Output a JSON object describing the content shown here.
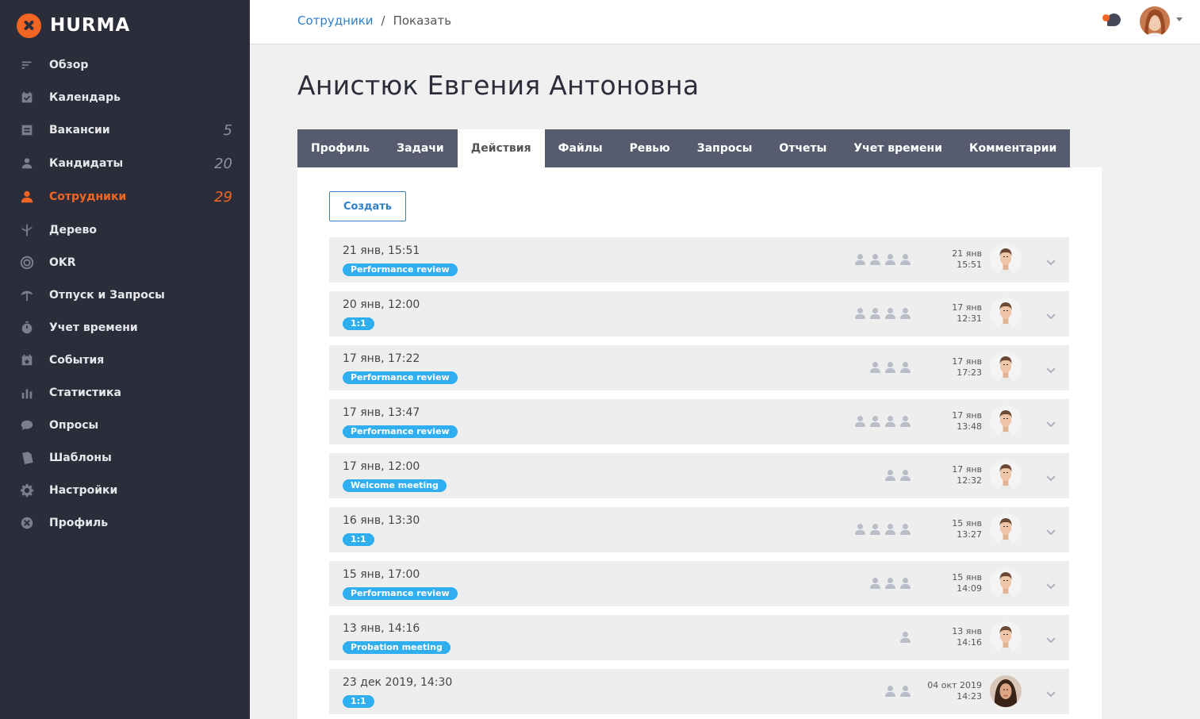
{
  "app": {
    "name": "HURMA"
  },
  "sidebar": {
    "items": [
      {
        "label": "Обзор",
        "icon": "overview-icon",
        "count": ""
      },
      {
        "label": "Календарь",
        "icon": "calendar-icon",
        "count": ""
      },
      {
        "label": "Вакансии",
        "icon": "vacancies-icon",
        "count": "5"
      },
      {
        "label": "Кандидаты",
        "icon": "candidates-icon",
        "count": "20"
      },
      {
        "label": "Сотрудники",
        "icon": "employees-icon",
        "count": "29",
        "active": true
      },
      {
        "label": "Дерево",
        "icon": "tree-icon",
        "count": ""
      },
      {
        "label": "OKR",
        "icon": "okr-icon",
        "count": ""
      },
      {
        "label": "Отпуск и Запросы",
        "icon": "vacation-icon",
        "count": ""
      },
      {
        "label": "Учет времени",
        "icon": "timer-icon",
        "count": ""
      },
      {
        "label": "События",
        "icon": "events-icon",
        "count": ""
      },
      {
        "label": "Статистика",
        "icon": "statistics-icon",
        "count": ""
      },
      {
        "label": "Опросы",
        "icon": "polls-icon",
        "count": ""
      },
      {
        "label": "Шаблоны",
        "icon": "templates-icon",
        "count": ""
      },
      {
        "label": "Настройки",
        "icon": "gear-icon",
        "count": ""
      },
      {
        "label": "Профиль",
        "icon": "profile-icon",
        "count": ""
      }
    ]
  },
  "header": {
    "breadcrumb": {
      "link": "Сотрудники",
      "separator": "/",
      "current": "Показать"
    }
  },
  "page": {
    "title": "Анистюк Евгения Антоновна",
    "tabs": [
      {
        "label": "Профиль"
      },
      {
        "label": "Задачи"
      },
      {
        "label": "Действия",
        "active": true
      },
      {
        "label": "Файлы"
      },
      {
        "label": "Ревью"
      },
      {
        "label": "Запросы"
      },
      {
        "label": "Отчеты"
      },
      {
        "label": "Учет времени"
      },
      {
        "label": "Комментарии"
      }
    ],
    "create_label": "Создать"
  },
  "actions": [
    {
      "title": "21 янв, 15:51",
      "tag": "Performance review",
      "participants": 4,
      "date": "21 янв",
      "time": "15:51",
      "author": "male"
    },
    {
      "title": "20 янв, 12:00",
      "tag": "1:1",
      "participants": 4,
      "date": "17 янв",
      "time": "12:31",
      "author": "male"
    },
    {
      "title": "17 янв, 17:22",
      "tag": "Performance review",
      "participants": 3,
      "date": "17 янв",
      "time": "17:23",
      "author": "male"
    },
    {
      "title": "17 янв, 13:47",
      "tag": "Performance review",
      "participants": 4,
      "date": "17 янв",
      "time": "13:48",
      "author": "male"
    },
    {
      "title": "17 янв, 12:00",
      "tag": "Welcome meeting",
      "participants": 2,
      "date": "17 янв",
      "time": "12:32",
      "author": "male"
    },
    {
      "title": "16 янв, 13:30",
      "tag": "1:1",
      "participants": 4,
      "date": "15 янв",
      "time": "13:27",
      "author": "male"
    },
    {
      "title": "15 янв, 17:00",
      "tag": "Performance review",
      "participants": 3,
      "date": "15 янв",
      "time": "14:09",
      "author": "male"
    },
    {
      "title": "13 янв, 14:16",
      "tag": "Probation meeting",
      "participants": 1,
      "date": "13 янв",
      "time": "14:16",
      "author": "male"
    },
    {
      "title": "23 дек 2019, 14:30",
      "tag": "1:1",
      "participants": 2,
      "date": "04 окт 2019",
      "time": "14:23",
      "author": "female"
    }
  ],
  "colors": {
    "sidebar_bg": "#2b2e3a",
    "accent": "#f26522",
    "link": "#2f80c9",
    "tag": "#2faef0",
    "tab_bar": "#565c6e"
  }
}
